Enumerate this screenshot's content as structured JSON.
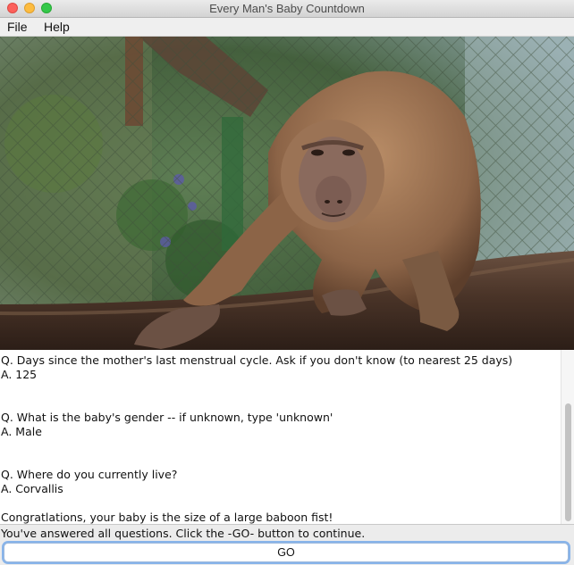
{
  "window": {
    "title": "Every Man's Baby Countdown"
  },
  "menu": {
    "items": [
      "File",
      "Help"
    ]
  },
  "image": {
    "subject": "baboon-photo"
  },
  "qa": [
    {
      "question": "Q. Days since the mother's last menstrual cycle. Ask if you don't know (to nearest 25 days)",
      "answer": "A. 125"
    },
    {
      "question": "Q. What is the baby's gender -- if unknown, type 'unknown'",
      "answer": "A. Male"
    },
    {
      "question": "Q. Where do you currently live?",
      "answer": "A. Corvallis"
    }
  ],
  "result": "Congratlations, your baby is the size of a large baboon fist!",
  "status": "You've answered all questions. Click the -GO- button to continue.",
  "go_button": "GO",
  "colors": {
    "button_focus": "#88b4ea",
    "close": "#fc605b",
    "minimize": "#fdbc40",
    "maximize": "#34c84a"
  }
}
